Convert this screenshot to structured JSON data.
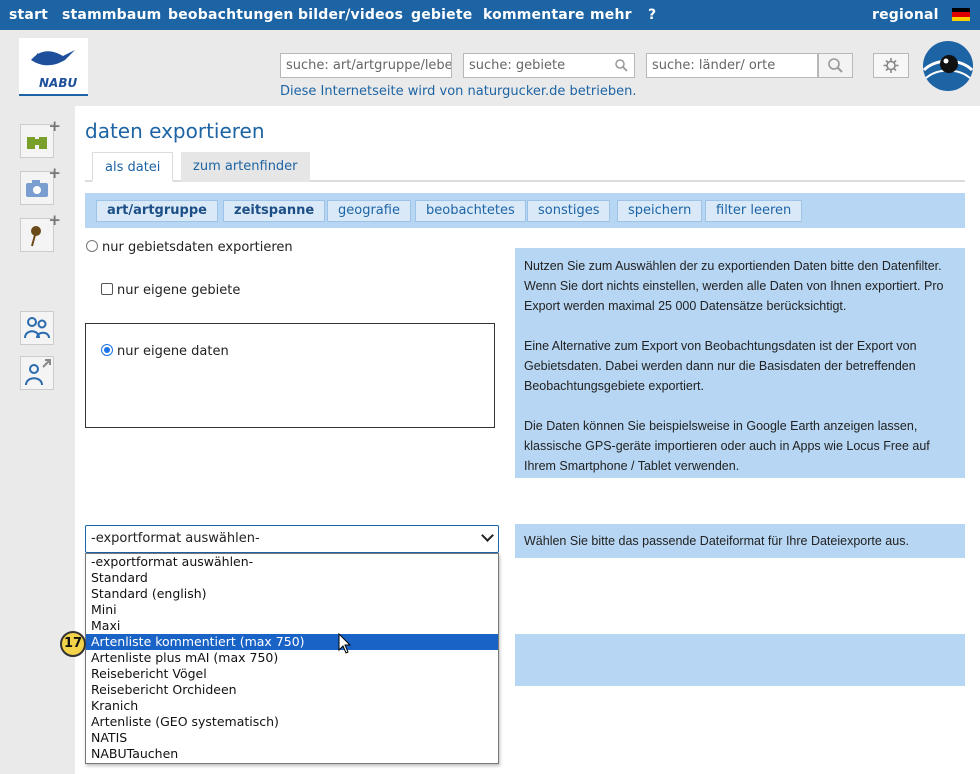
{
  "topnav": {
    "items": [
      "start",
      "stammbaum",
      "beobachtungen",
      "bilder/videos",
      "gebiete",
      "kommentare",
      "mehr",
      "?"
    ],
    "regional": "regional"
  },
  "header": {
    "logo_text": "NABU",
    "search_species_placeholder": "suche: art/artgruppe/leber",
    "search_areas_placeholder": "suche: gebiete",
    "search_places_placeholder": "suche: länder/ orte",
    "tagline": "Diese Internetseite wird von naturgucker.de betrieben."
  },
  "page": {
    "title": "daten exportieren",
    "tabs": [
      "als datei",
      "zum artenfinder"
    ],
    "filters": [
      "art/artgruppe",
      "zeitspanne",
      "geografie",
      "beobachtetes",
      "sonstiges",
      "speichern",
      "filter leeren"
    ]
  },
  "options": {
    "area_data_only": "nur gebietsdaten exportieren",
    "own_areas": "nur eigene gebiete",
    "own_data": "nur eigene daten"
  },
  "info": {
    "p1": "Nutzen Sie zum Auswählen der zu exportienden Daten bitte den Datenfilter. Wenn Sie dort nichts einstellen, werden alle Daten von Ihnen exportiert. Pro Export werden maximal 25 000 Datensätze berücksichtigt.",
    "p2": "Eine Alternative zum Export von Beobachtungsdaten ist der Export von Gebietsdaten. Dabei werden dann nur die Basisdaten der betreffenden Beobachtungsgebiete exportiert.",
    "p3": "Die Daten können Sie beispielsweise in Google Earth anzeigen lassen, klassische GPS-geräte importieren oder auch in Apps wie Locus Free auf Ihrem Smartphone / Tablet verwenden.",
    "format_hint": "Wählen Sie bitte das passende Dateiformat für Ihre Dateiexporte aus."
  },
  "export_select": {
    "value": "-exportformat auswählen-",
    "options": [
      "-exportformat auswählen-",
      "Standard",
      "Standard (english)",
      "Mini",
      "Maxi",
      "Artenliste kommentiert (max 750)",
      "Artenliste plus mAI (max 750)",
      "Reisebericht Vögel",
      "Reisebericht Orchideen",
      "Kranich",
      "Artenliste (GEO systematisch)",
      "NATIS",
      "NABUTauchen"
    ],
    "highlighted_index": 5
  },
  "step_marker": "17",
  "colors": {
    "nav_blue": "#1d64a4",
    "panel_blue": "#b7d6f3",
    "highlight": "#1a63c6",
    "marker_yellow": "#f3d34a"
  }
}
